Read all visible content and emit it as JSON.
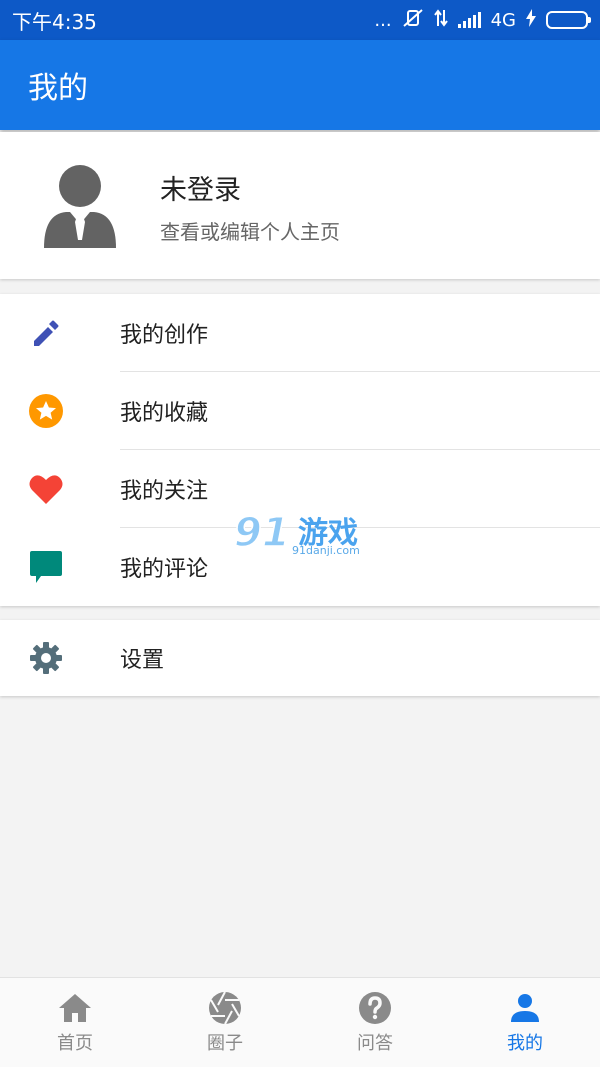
{
  "status_bar": {
    "time": "下午4:35",
    "dots": "...",
    "network": "4G"
  },
  "app_bar": {
    "title": "我的"
  },
  "profile": {
    "name": "未登录",
    "subtitle": "查看或编辑个人主页"
  },
  "menu": {
    "items": [
      {
        "label": "我的创作",
        "icon": "pencil-icon",
        "color": "#3f51b5"
      },
      {
        "label": "我的收藏",
        "icon": "star-icon",
        "color": "#ff9800"
      },
      {
        "label": "我的关注",
        "icon": "heart-icon",
        "color": "#f44336"
      },
      {
        "label": "我的评论",
        "icon": "comment-icon",
        "color": "#00897b"
      }
    ]
  },
  "settings": {
    "label": "设置",
    "icon": "gear-icon",
    "color": "#546e7a"
  },
  "watermark": {
    "brand": "游戏",
    "domain": "91danji.com"
  },
  "bottom_nav": {
    "items": [
      {
        "label": "首页",
        "icon": "home-icon",
        "active": false
      },
      {
        "label": "圈子",
        "icon": "aperture-icon",
        "active": false
      },
      {
        "label": "问答",
        "icon": "question-icon",
        "active": false
      },
      {
        "label": "我的",
        "icon": "person-icon",
        "active": true
      }
    ]
  },
  "colors": {
    "status_bar": "#0d59c7",
    "primary": "#1677e6",
    "inactive": "#8a8a8a"
  }
}
